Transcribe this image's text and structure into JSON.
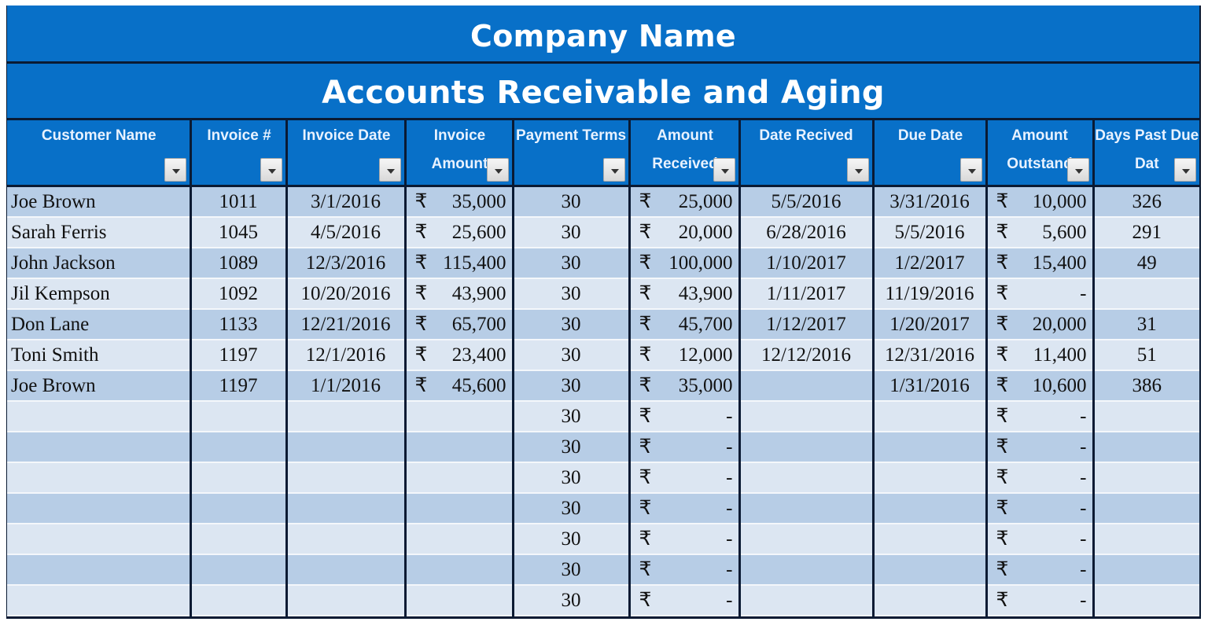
{
  "header": {
    "company_name": "Company Name",
    "report_title": "Accounts Receivable and Aging"
  },
  "colors": {
    "header_blue": "#0870c8",
    "row_dark": "#b7cde6",
    "row_light": "#dce6f2",
    "border": "#0a1a33"
  },
  "currency_symbol": "₹",
  "columns": [
    {
      "key": "customer",
      "label": "Customer Name",
      "filter_icon": "dropdown-arrow-icon"
    },
    {
      "key": "invoice_no",
      "label": "Invoice #",
      "filter_icon": "dropdown-arrow-icon"
    },
    {
      "key": "invoice_date",
      "label": "Invoice Date",
      "filter_icon": "dropdown-arrow-icon"
    },
    {
      "key": "invoice_amount",
      "label": "Invoice Amount",
      "filter_icon": "dropdown-arrow-icon"
    },
    {
      "key": "payment_terms",
      "label": "Payment Terms",
      "filter_icon": "dropdown-arrow-icon"
    },
    {
      "key": "amount_received",
      "label": "Amount Received",
      "filter_icon": "dropdown-arrow-icon"
    },
    {
      "key": "date_received",
      "label": "Date Recived",
      "filter_icon": "dropdown-arrow-icon"
    },
    {
      "key": "due_date",
      "label": "Due Date",
      "filter_icon": "dropdown-arrow-icon"
    },
    {
      "key": "amount_outstanding",
      "label": "Amount Outstand",
      "filter_icon": "dropdown-arrow-icon"
    },
    {
      "key": "days_past_due",
      "label": "Days Past Due Dat",
      "filter_icon": "dropdown-arrow-icon"
    }
  ],
  "rows": [
    {
      "customer": "Joe Brown",
      "invoice_no": "1011",
      "invoice_date": "3/1/2016",
      "invoice_amount": "35,000",
      "payment_terms": "30",
      "amount_received": "25,000",
      "date_received": "5/5/2016",
      "due_date": "3/31/2016",
      "amount_outstanding": "10,000",
      "days_past_due": "326"
    },
    {
      "customer": "Sarah Ferris",
      "invoice_no": "1045",
      "invoice_date": "4/5/2016",
      "invoice_amount": "25,600",
      "payment_terms": "30",
      "amount_received": "20,000",
      "date_received": "6/28/2016",
      "due_date": "5/5/2016",
      "amount_outstanding": "5,600",
      "days_past_due": "291"
    },
    {
      "customer": "John Jackson",
      "invoice_no": "1089",
      "invoice_date": "12/3/2016",
      "invoice_amount": "115,400",
      "payment_terms": "30",
      "amount_received": "100,000",
      "date_received": "1/10/2017",
      "due_date": "1/2/2017",
      "amount_outstanding": "15,400",
      "days_past_due": "49"
    },
    {
      "customer": "Jil Kempson",
      "invoice_no": "1092",
      "invoice_date": "10/20/2016",
      "invoice_amount": "43,900",
      "payment_terms": "30",
      "amount_received": "43,900",
      "date_received": "1/11/2017",
      "due_date": "11/19/2016",
      "amount_outstanding": "-",
      "days_past_due": ""
    },
    {
      "customer": "Don Lane",
      "invoice_no": "1133",
      "invoice_date": "12/21/2016",
      "invoice_amount": "65,700",
      "payment_terms": "30",
      "amount_received": "45,700",
      "date_received": "1/12/2017",
      "due_date": "1/20/2017",
      "amount_outstanding": "20,000",
      "days_past_due": "31"
    },
    {
      "customer": "Toni Smith",
      "invoice_no": "1197",
      "invoice_date": "12/1/2016",
      "invoice_amount": "23,400",
      "payment_terms": "30",
      "amount_received": "12,000",
      "date_received": "12/12/2016",
      "due_date": "12/31/2016",
      "amount_outstanding": "11,400",
      "days_past_due": "51"
    },
    {
      "customer": "Joe Brown",
      "invoice_no": "1197",
      "invoice_date": "1/1/2016",
      "invoice_amount": "45,600",
      "payment_terms": "30",
      "amount_received": "35,000",
      "date_received": "",
      "due_date": "1/31/2016",
      "amount_outstanding": "10,600",
      "days_past_due": "386"
    },
    {
      "customer": "",
      "invoice_no": "",
      "invoice_date": "",
      "invoice_amount": "",
      "payment_terms": "30",
      "amount_received": "-",
      "date_received": "",
      "due_date": "",
      "amount_outstanding": "-",
      "days_past_due": ""
    },
    {
      "customer": "",
      "invoice_no": "",
      "invoice_date": "",
      "invoice_amount": "",
      "payment_terms": "30",
      "amount_received": "-",
      "date_received": "",
      "due_date": "",
      "amount_outstanding": "-",
      "days_past_due": ""
    },
    {
      "customer": "",
      "invoice_no": "",
      "invoice_date": "",
      "invoice_amount": "",
      "payment_terms": "30",
      "amount_received": "-",
      "date_received": "",
      "due_date": "",
      "amount_outstanding": "-",
      "days_past_due": ""
    },
    {
      "customer": "",
      "invoice_no": "",
      "invoice_date": "",
      "invoice_amount": "",
      "payment_terms": "30",
      "amount_received": "-",
      "date_received": "",
      "due_date": "",
      "amount_outstanding": "-",
      "days_past_due": ""
    },
    {
      "customer": "",
      "invoice_no": "",
      "invoice_date": "",
      "invoice_amount": "",
      "payment_terms": "30",
      "amount_received": "-",
      "date_received": "",
      "due_date": "",
      "amount_outstanding": "-",
      "days_past_due": ""
    },
    {
      "customer": "",
      "invoice_no": "",
      "invoice_date": "",
      "invoice_amount": "",
      "payment_terms": "30",
      "amount_received": "-",
      "date_received": "",
      "due_date": "",
      "amount_outstanding": "-",
      "days_past_due": ""
    },
    {
      "customer": "",
      "invoice_no": "",
      "invoice_date": "",
      "invoice_amount": "",
      "payment_terms": "30",
      "amount_received": "-",
      "date_received": "",
      "due_date": "",
      "amount_outstanding": "-",
      "days_past_due": ""
    }
  ]
}
